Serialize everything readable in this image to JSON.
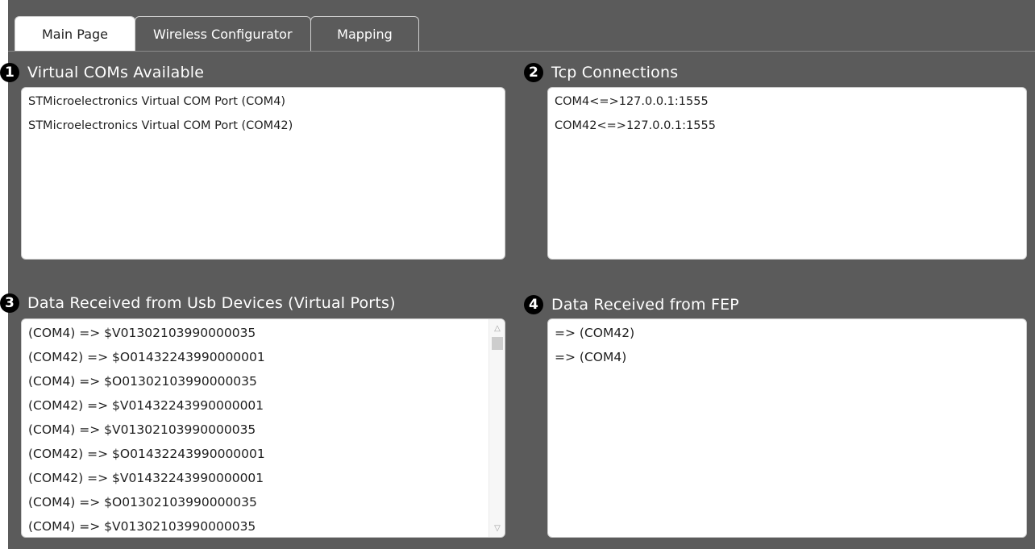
{
  "tabs": [
    {
      "label": "Main Page",
      "active": true
    },
    {
      "label": "Wireless Configurator",
      "active": false
    },
    {
      "label": "Mapping",
      "active": false
    }
  ],
  "sections": {
    "virtual_coms": {
      "number": "1",
      "title": "Virtual COMs Available",
      "items": [
        "STMicroelectronics Virtual COM Port (COM4)",
        "STMicroelectronics Virtual COM Port (COM42)"
      ]
    },
    "tcp": {
      "number": "2",
      "title": "Tcp Connections",
      "items": [
        "COM4<=>127.0.0.1:1555",
        "COM42<=>127.0.0.1:1555"
      ]
    },
    "usb_data": {
      "number": "3",
      "title": "Data Received from Usb Devices (Virtual Ports)",
      "items": [
        "(COM4) => $V01302103990000035",
        "(COM42) => $O01432243990000001",
        "(COM4) => $O01302103990000035",
        "(COM42) => $V01432243990000001",
        "(COM4) => $V01302103990000035",
        "(COM42) => $O01432243990000001",
        "(COM42) => $V01432243990000001",
        "(COM4) => $O01302103990000035",
        "(COM4) => $V01302103990000035"
      ]
    },
    "fep_data": {
      "number": "4",
      "title": "Data Received from FEP",
      "items": [
        "=> (COM42)",
        "=> (COM4)"
      ]
    }
  },
  "colors": {
    "background": "#5b5b5b",
    "panel": "#ffffff",
    "badge": "#000000"
  }
}
